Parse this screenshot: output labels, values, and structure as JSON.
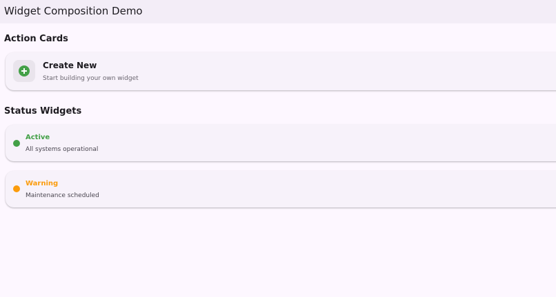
{
  "app_bar": {
    "title": "Widget Composition Demo"
  },
  "sections": {
    "action_cards": {
      "title": "Action Cards",
      "cards": [
        {
          "title": "Create New",
          "subtitle": "Start building your own widget",
          "icon": "add-circle-icon",
          "icon_color": "#43a047"
        }
      ]
    },
    "status_widgets": {
      "title": "Status Widgets",
      "items": [
        {
          "status": "Active",
          "message": "All systems operational",
          "color": "#43a047"
        },
        {
          "status": "Warning",
          "message": "Maintenance scheduled",
          "color": "#fb9c0c"
        }
      ]
    }
  }
}
